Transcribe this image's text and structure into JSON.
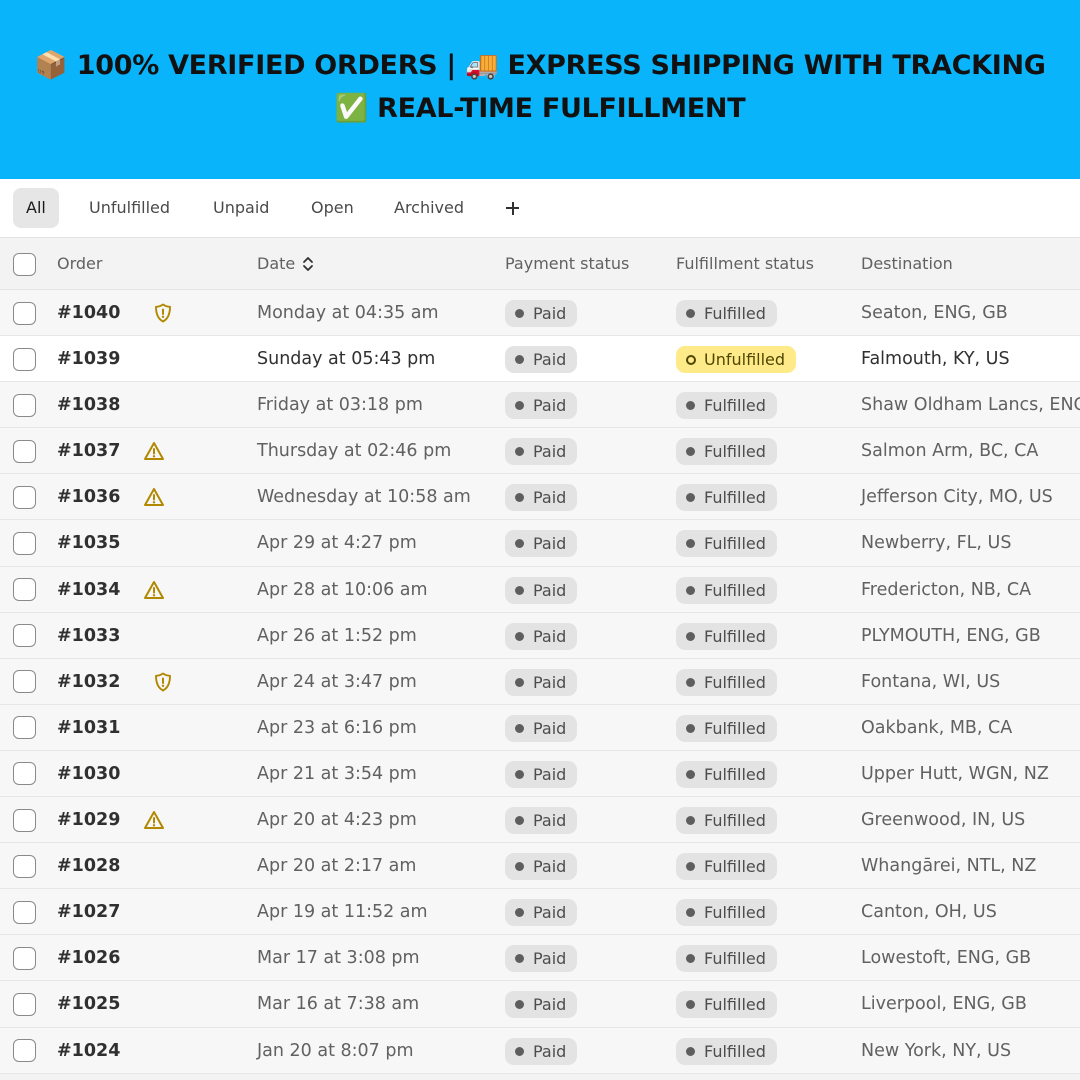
{
  "banner": {
    "line1": "📦 100% VERIFIED ORDERS | 🚚 EXPRESS SHIPPING WITH TRACKING",
    "line2": "✅ REAL-TIME FULFILLMENT"
  },
  "tabs": [
    {
      "label": "All",
      "active": true
    },
    {
      "label": "Unfulfilled"
    },
    {
      "label": "Unpaid"
    },
    {
      "label": "Open"
    },
    {
      "label": "Archived"
    }
  ],
  "columns": {
    "order": "Order",
    "date": "Date",
    "payment": "Payment status",
    "fulfillment": "Fulfillment status",
    "destination": "Destination"
  },
  "colors": {
    "banner": "#0ab4fb",
    "warning_icon": "#b28800",
    "unfulfilled_badge": "#ffea8a"
  },
  "orders": [
    {
      "id": "#1040",
      "flag": "shield-alert-icon",
      "date": "Monday at 04:35 am",
      "payment": "Paid",
      "fulfillment": "Fulfilled",
      "destination": "Seaton, ENG, GB"
    },
    {
      "id": "#1039",
      "flag": "",
      "date": "Sunday at 05:43 pm",
      "payment": "Paid",
      "fulfillment": "Unfulfilled",
      "destination": "Falmouth, KY, US",
      "highlight": true
    },
    {
      "id": "#1038",
      "flag": "",
      "date": "Friday at 03:18 pm",
      "payment": "Paid",
      "fulfillment": "Fulfilled",
      "destination": "Shaw Oldham Lancs, ENG"
    },
    {
      "id": "#1037",
      "flag": "warning-icon",
      "date": "Thursday at 02:46 pm",
      "payment": "Paid",
      "fulfillment": "Fulfilled",
      "destination": "Salmon Arm, BC, CA"
    },
    {
      "id": "#1036",
      "flag": "warning-icon",
      "date": "Wednesday at 10:58 am",
      "payment": "Paid",
      "fulfillment": "Fulfilled",
      "destination": "Jefferson City, MO, US"
    },
    {
      "id": "#1035",
      "flag": "",
      "date": "Apr 29 at 4:27 pm",
      "payment": "Paid",
      "fulfillment": "Fulfilled",
      "destination": "Newberry, FL, US"
    },
    {
      "id": "#1034",
      "flag": "warning-icon",
      "date": "Apr 28 at 10:06 am",
      "payment": "Paid",
      "fulfillment": "Fulfilled",
      "destination": "Fredericton, NB, CA"
    },
    {
      "id": "#1033",
      "flag": "",
      "date": "Apr 26 at 1:52 pm",
      "payment": "Paid",
      "fulfillment": "Fulfilled",
      "destination": "PLYMOUTH, ENG, GB"
    },
    {
      "id": "#1032",
      "flag": "shield-alert-icon",
      "date": "Apr 24 at 3:47 pm",
      "payment": "Paid",
      "fulfillment": "Fulfilled",
      "destination": "Fontana, WI, US"
    },
    {
      "id": "#1031",
      "flag": "",
      "date": "Apr 23 at 6:16 pm",
      "payment": "Paid",
      "fulfillment": "Fulfilled",
      "destination": "Oakbank, MB, CA"
    },
    {
      "id": "#1030",
      "flag": "",
      "date": "Apr 21 at 3:54 pm",
      "payment": "Paid",
      "fulfillment": "Fulfilled",
      "destination": "Upper Hutt, WGN, NZ"
    },
    {
      "id": "#1029",
      "flag": "warning-icon",
      "date": "Apr 20 at 4:23 pm",
      "payment": "Paid",
      "fulfillment": "Fulfilled",
      "destination": "Greenwood, IN, US"
    },
    {
      "id": "#1028",
      "flag": "",
      "date": "Apr 20 at 2:17 am",
      "payment": "Paid",
      "fulfillment": "Fulfilled",
      "destination": "Whangārei, NTL, NZ"
    },
    {
      "id": "#1027",
      "flag": "",
      "date": "Apr 19 at 11:52 am",
      "payment": "Paid",
      "fulfillment": "Fulfilled",
      "destination": "Canton, OH, US"
    },
    {
      "id": "#1026",
      "flag": "",
      "date": "Mar 17 at 3:08 pm",
      "payment": "Paid",
      "fulfillment": "Fulfilled",
      "destination": "Lowestoft, ENG, GB"
    },
    {
      "id": "#1025",
      "flag": "",
      "date": "Mar 16 at 7:38 am",
      "payment": "Paid",
      "fulfillment": "Fulfilled",
      "destination": "Liverpool, ENG, GB"
    },
    {
      "id": "#1024",
      "flag": "",
      "date": "Jan 20 at 8:07 pm",
      "payment": "Paid",
      "fulfillment": "Fulfilled",
      "destination": "New York, NY, US"
    }
  ]
}
